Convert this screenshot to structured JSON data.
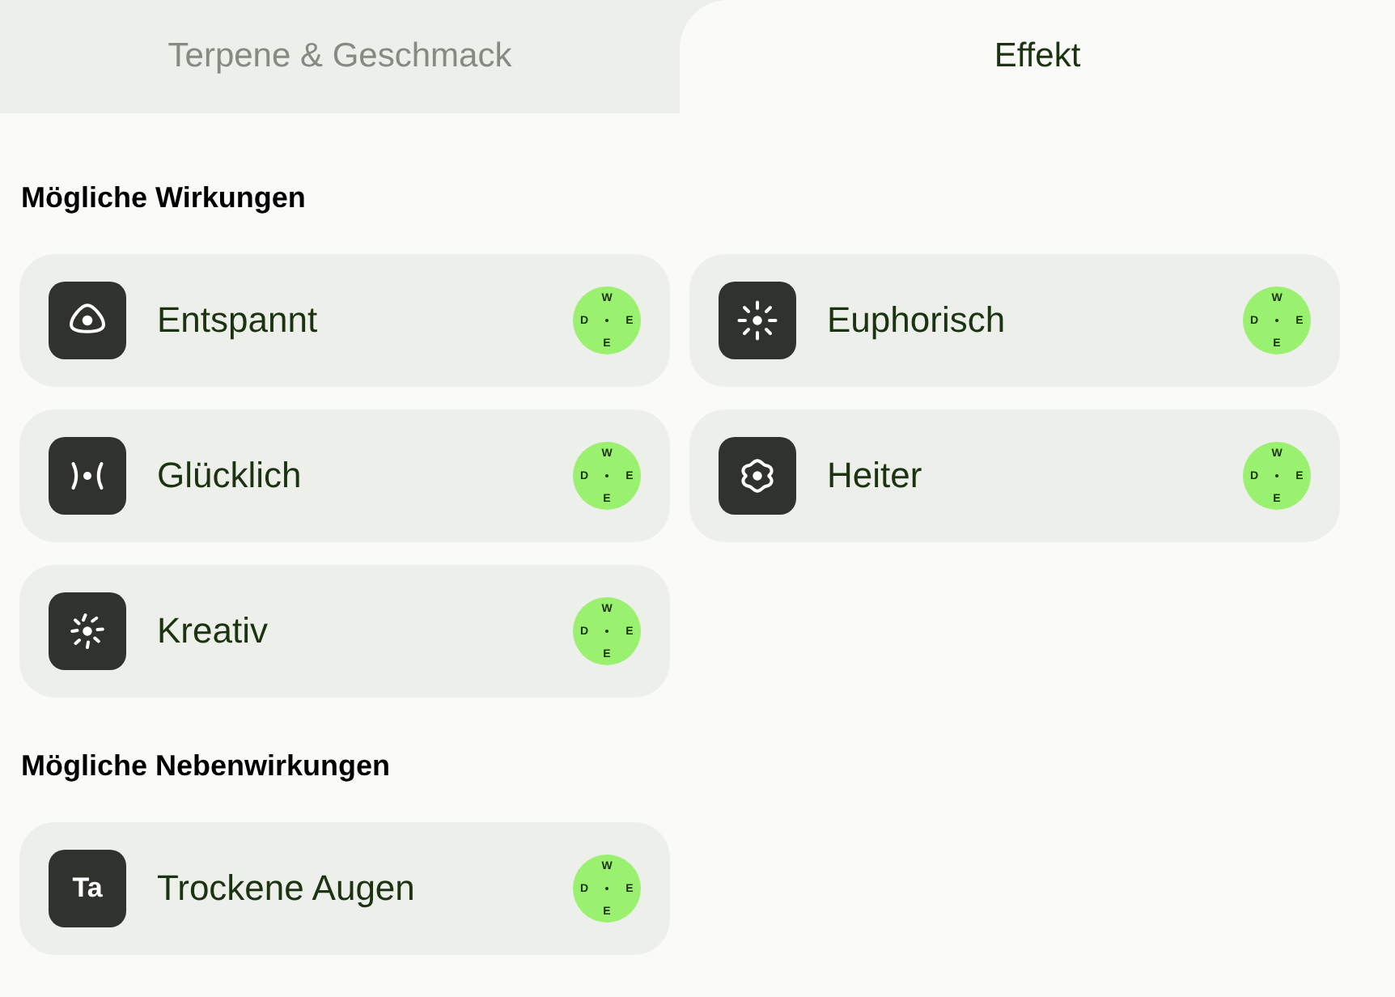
{
  "tabs": [
    {
      "label": "Terpene & Geschmack",
      "selected": false
    },
    {
      "label": "Effekt",
      "selected": true
    }
  ],
  "sections": [
    {
      "title": "Mögliche Wirkungen",
      "items": [
        {
          "label": "Entspannt",
          "badge": {
            "top": "W",
            "left": "D",
            "right": "E",
            "bottom": "E"
          }
        },
        {
          "label": "Euphorisch",
          "badge": {
            "top": "W",
            "left": "D",
            "right": "E",
            "bottom": "E"
          }
        },
        {
          "label": "Glücklich",
          "badge": {
            "top": "W",
            "left": "D",
            "right": "E",
            "bottom": "E"
          }
        },
        {
          "label": "Heiter",
          "badge": {
            "top": "W",
            "left": "D",
            "right": "E",
            "bottom": "E"
          }
        },
        {
          "label": "Kreativ",
          "badge": {
            "top": "W",
            "left": "D",
            "right": "E",
            "bottom": "E"
          }
        }
      ]
    },
    {
      "title": "Mögliche Nebenwirkungen",
      "items": [
        {
          "label": "Trockene Augen",
          "icon_text": "Ta",
          "badge": {
            "top": "W",
            "left": "D",
            "right": "E",
            "bottom": "E"
          }
        }
      ]
    }
  ]
}
